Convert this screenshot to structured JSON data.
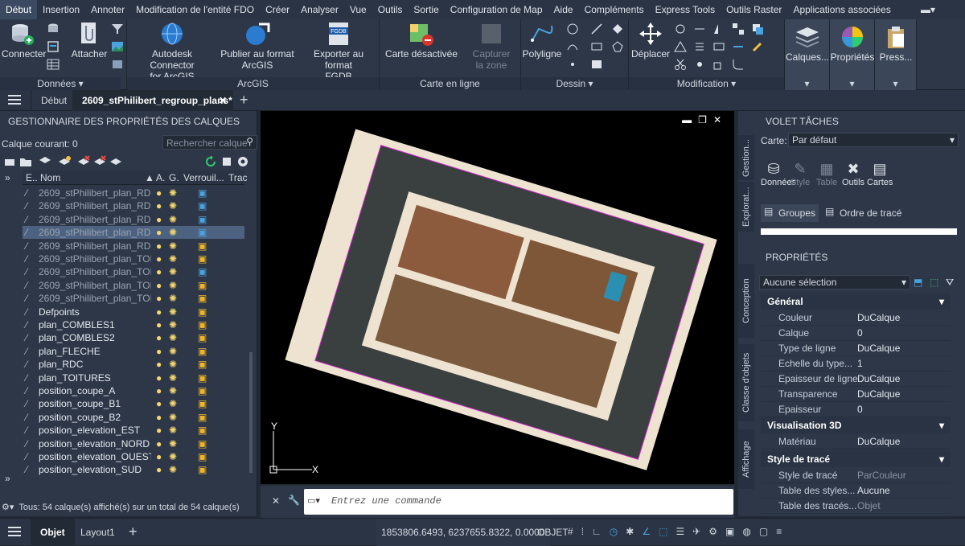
{
  "menubar": [
    "Début",
    "Insertion",
    "Annoter",
    "Modification de l'entité FDO",
    "Créer",
    "Analyser",
    "Vue",
    "Outils",
    "Sortie",
    "Configuration de Map",
    "Aide",
    "Compléments",
    "Express Tools",
    "Outils Raster",
    "Applications associées"
  ],
  "ribbon": {
    "connect": "Connecter",
    "attach": "Attacher",
    "donnees": "Données",
    "arcgis_connector": [
      "Autodesk Connector",
      "for ArcGIS"
    ],
    "publish": [
      "Publier au format",
      "ArcGIS"
    ],
    "export": [
      "Exporter au format",
      "FGDB"
    ],
    "arcgis": "ArcGIS",
    "map_off": "Carte désactivée",
    "capture": [
      "Capturer",
      "la zone"
    ],
    "online_map": "Carte en ligne",
    "polyline": "Polyligne",
    "dessin": "Dessin",
    "move": "Déplacer",
    "modification": "Modification",
    "layers": "Calques...",
    "properties": "Propriétés",
    "press": "Press..."
  },
  "docbar": {
    "start": "Début",
    "doc_tab": "2609_stPhilibert_regroup_plans*"
  },
  "layers_panel": {
    "title": "GESTIONNAIRE DES PROPRIÉTÉS DES CALQUES",
    "current": "Calque courant: 0",
    "search_placeholder": "Rechercher calque",
    "cols": {
      "e": "E..",
      "name": "Nom",
      "a": "A.",
      "g": "G.",
      "lock": "Verrouil...",
      "plot": "Trac"
    },
    "layers": [
      {
        "name": "2609_stPhilibert_plan_RD...",
        "dim": true,
        "locked": true
      },
      {
        "name": "2609_stPhilibert_plan_RD...",
        "dim": true,
        "locked": true
      },
      {
        "name": "2609_stPhilibert_plan_RD...",
        "dim": true,
        "locked": true
      },
      {
        "name": "2609_stPhilibert_plan_RD...",
        "dim": true,
        "locked": true,
        "selected": true
      },
      {
        "name": "2609_stPhilibert_plan_RD...",
        "dim": true,
        "locked": false
      },
      {
        "name": "2609_stPhilibert_plan_TOI...",
        "dim": true,
        "locked": false
      },
      {
        "name": "2609_stPhilibert_plan_TOI...",
        "dim": true,
        "locked": true
      },
      {
        "name": "2609_stPhilibert_plan_TOI...",
        "dim": true,
        "locked": false
      },
      {
        "name": "2609_stPhilibert_plan_TOI...",
        "dim": true,
        "locked": false
      },
      {
        "name": "Defpoints",
        "dim": false,
        "locked": false
      },
      {
        "name": "plan_COMBLES1",
        "dim": false,
        "locked": false
      },
      {
        "name": "plan_COMBLES2",
        "dim": false,
        "locked": false
      },
      {
        "name": "plan_FLECHE",
        "dim": false,
        "locked": false
      },
      {
        "name": "plan_RDC",
        "dim": false,
        "locked": false
      },
      {
        "name": "plan_TOITURES",
        "dim": false,
        "locked": false
      },
      {
        "name": "position_coupe_A",
        "dim": false,
        "locked": false
      },
      {
        "name": "position_coupe_B1",
        "dim": false,
        "locked": false
      },
      {
        "name": "position_coupe_B2",
        "dim": false,
        "locked": false
      },
      {
        "name": "position_elevation_EST",
        "dim": false,
        "locked": false
      },
      {
        "name": "position_elevation_NORD",
        "dim": false,
        "locked": false
      },
      {
        "name": "position_elevation_OUEST",
        "dim": false,
        "locked": false
      },
      {
        "name": "position_elevation_SUD",
        "dim": false,
        "locked": false
      }
    ],
    "footer": "Tous: 54 calque(s) affiché(s) sur un total de 54 calque(s)"
  },
  "command": {
    "placeholder": "Entrez une commande"
  },
  "task_pane": {
    "title": "VOLET TÂCHES",
    "map_label": "Carte:",
    "map_value": "Par défaut",
    "tabs_vertical": [
      "Gestion...",
      "Explorat..."
    ],
    "tools": [
      "Données",
      "Style",
      "Table",
      "Outils",
      "Cartes"
    ],
    "groups": "Groupes",
    "draw_order": "Ordre de tracé"
  },
  "properties": {
    "title": "PROPRIÉTÉS",
    "selection": "Aucune sélection",
    "vtabs": [
      "Conception",
      "Classe d'objets",
      "Affichage"
    ],
    "general": "Général",
    "rows": [
      {
        "k": "Couleur",
        "v": "DuCalque"
      },
      {
        "k": "Calque",
        "v": "0"
      },
      {
        "k": "Type de ligne",
        "v": "DuCalque"
      },
      {
        "k": "Echelle du type...",
        "v": "1"
      },
      {
        "k": "Epaisseur de ligne",
        "v": "DuCalque"
      },
      {
        "k": "Transparence",
        "v": "DuCalque"
      },
      {
        "k": "Epaisseur",
        "v": "0"
      }
    ],
    "vis3d": "Visualisation 3D",
    "material_k": "Matériau",
    "material_v": "DuCalque",
    "plotstyle": "Style de tracé",
    "ps_rows": [
      {
        "k": "Style de tracé",
        "v": "ParCouleur"
      },
      {
        "k": "Table des styles...",
        "v": "Aucune"
      },
      {
        "k": "Table des tracés...",
        "v": "Objet"
      }
    ]
  },
  "statusbar": {
    "model": "Objet",
    "layout": "Layout1",
    "coords": "1853806.6493, 6237655.8322, 0.0000",
    "mode": "OBJET"
  }
}
